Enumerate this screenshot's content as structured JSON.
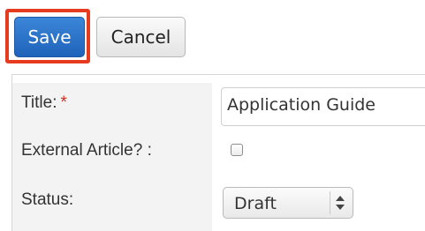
{
  "toolbar": {
    "save_label": "Save",
    "cancel_label": "Cancel"
  },
  "form": {
    "title": {
      "label": "Title:",
      "required_marker": "*",
      "value": "Application Guide"
    },
    "external_article": {
      "label": "External Article? :",
      "checked": false
    },
    "status": {
      "label": "Status:",
      "selected": "Draft"
    }
  },
  "colors": {
    "highlight": "#e63b1f",
    "primary_button": "#1f63bb",
    "required_star": "#d52b1e",
    "label_background": "#f3f3f3"
  },
  "icons": {
    "select_arrows": "up-down-arrows-icon"
  }
}
